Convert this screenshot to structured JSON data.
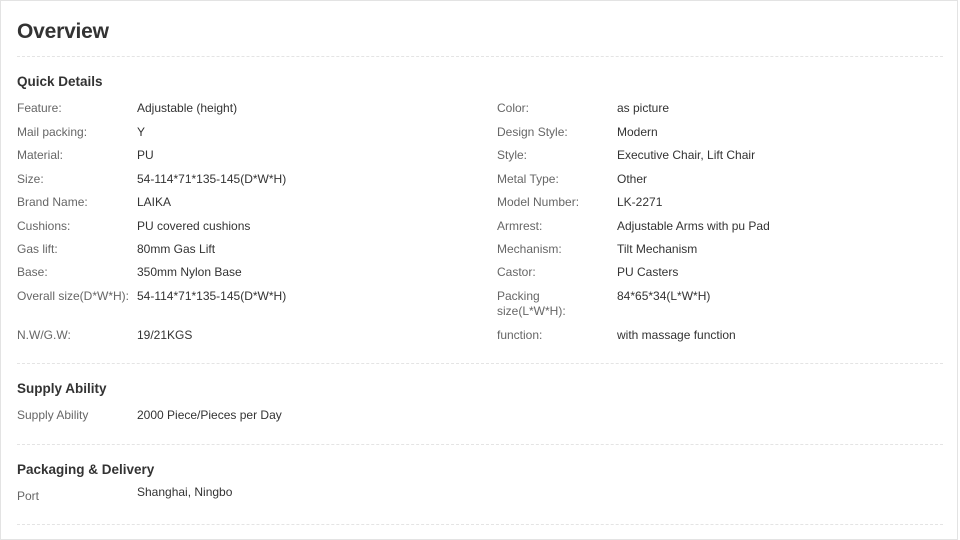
{
  "overview_title": "Overview",
  "quick_details": {
    "title": "Quick Details",
    "left": [
      {
        "label": "Feature:",
        "value": "Adjustable (height)"
      },
      {
        "label": "Mail packing:",
        "value": "Y"
      },
      {
        "label": "Material:",
        "value": "PU"
      },
      {
        "label": "Size:",
        "value": "54-114*71*135-145(D*W*H)"
      },
      {
        "label": "Brand Name:",
        "value": "LAIKA"
      },
      {
        "label": "Cushions:",
        "value": "PU covered cushions"
      },
      {
        "label": "Gas lift:",
        "value": "80mm Gas Lift"
      },
      {
        "label": "Base:",
        "value": "350mm Nylon Base"
      },
      {
        "label": "Overall size(D*W*H):",
        "value": "54-114*71*135-145(D*W*H)"
      },
      {
        "label": "N.W/G.W:",
        "value": "19/21KGS"
      }
    ],
    "right": [
      {
        "label": "Color:",
        "value": "as picture"
      },
      {
        "label": "Design Style:",
        "value": "Modern"
      },
      {
        "label": "Style:",
        "value": "Executive Chair, Lift Chair"
      },
      {
        "label": "Metal Type:",
        "value": "Other"
      },
      {
        "label": "Model Number:",
        "value": "LK-2271"
      },
      {
        "label": "Armrest:",
        "value": "Adjustable Arms with pu Pad"
      },
      {
        "label": "Mechanism:",
        "value": "Tilt Mechanism"
      },
      {
        "label": "Castor:",
        "value": "PU Casters"
      },
      {
        "label": "Packing size(L*W*H):",
        "value": "84*65*34(L*W*H)"
      },
      {
        "label": "function:",
        "value": "with massage function"
      }
    ]
  },
  "supply_ability": {
    "title": "Supply Ability",
    "rows": [
      {
        "label": "Supply Ability",
        "value": "2000 Piece/Pieces per Day"
      }
    ]
  },
  "packaging_delivery": {
    "title": "Packaging & Delivery",
    "rows": [
      {
        "label": "Port",
        "value": "Shanghai, Ningbo"
      }
    ]
  }
}
